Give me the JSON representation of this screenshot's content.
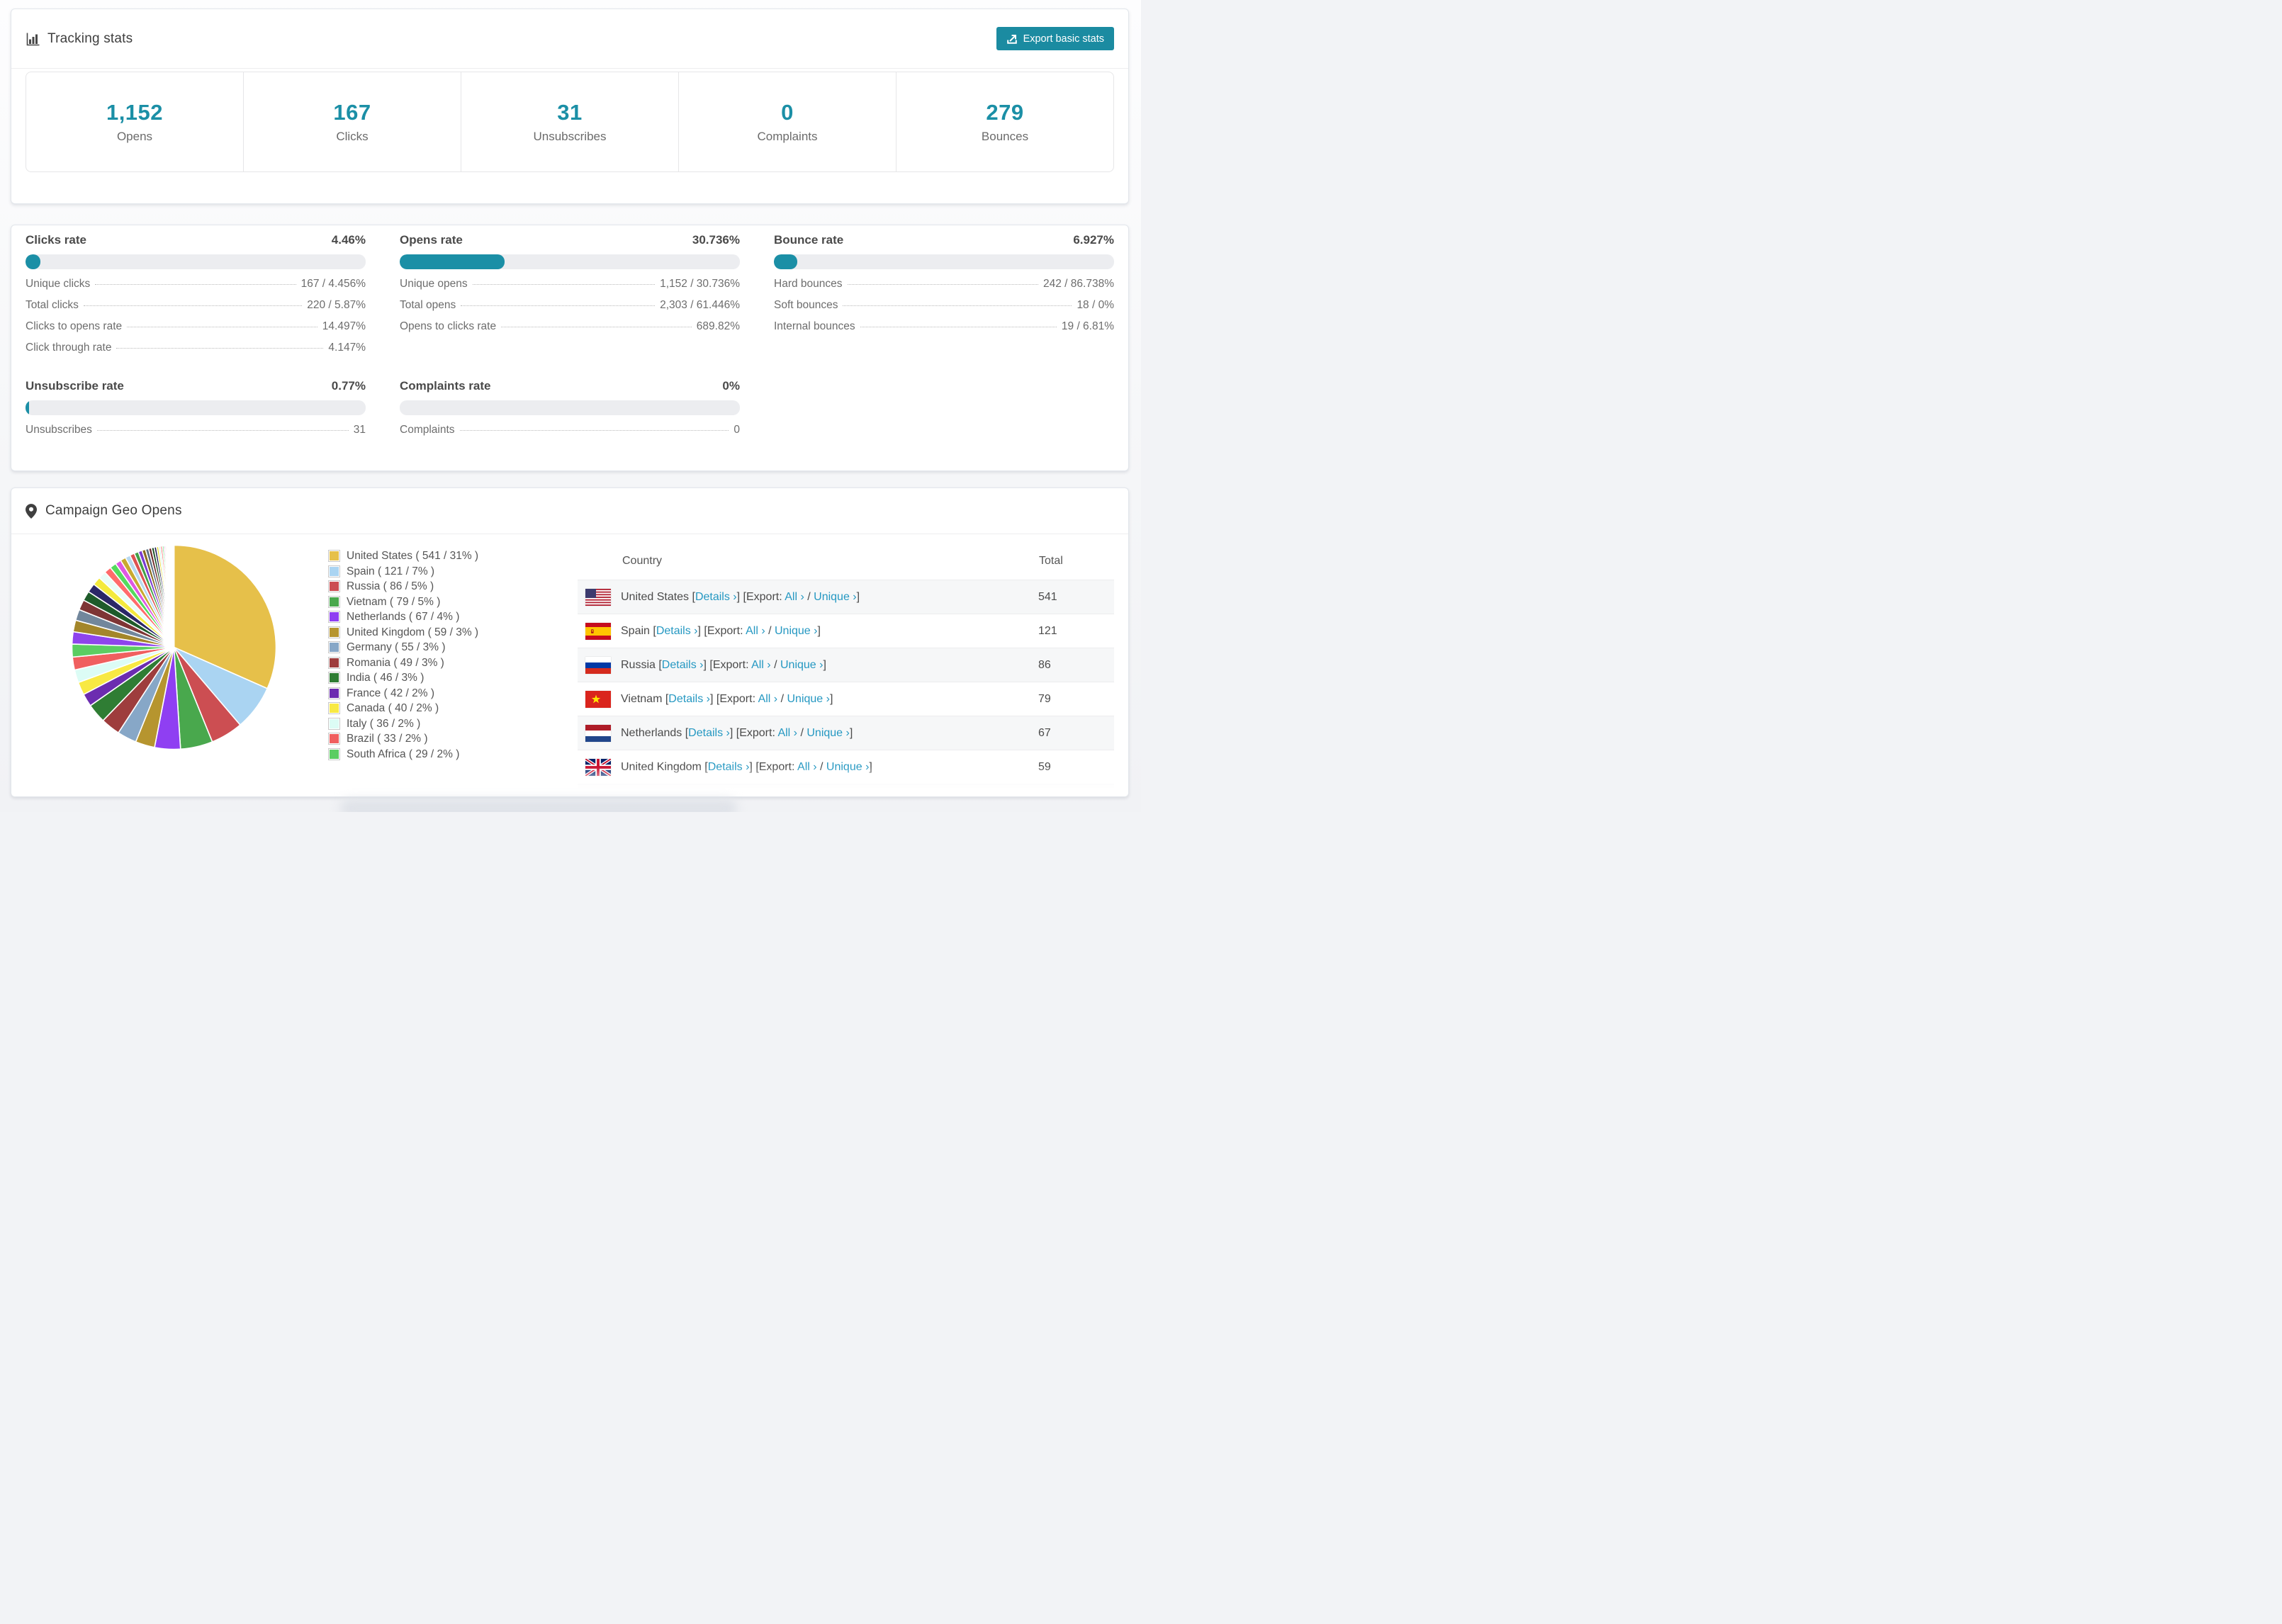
{
  "colors": {
    "accent_teal": "#1b8fa6",
    "button_teal": "#1b8ba1",
    "link_blue": "#2598c2",
    "bar_track": "#ecedf0",
    "table_alt_row": "#f6f7f8",
    "title_text": "#3e3e3e",
    "muted_text": "#6b6b6b"
  },
  "header_card": {
    "title": "Tracking stats",
    "export_button": "Export basic stats"
  },
  "stats": [
    {
      "label": "Opens",
      "value": "1,152"
    },
    {
      "label": "Clicks",
      "value": "167"
    },
    {
      "label": "Unsubscribes",
      "value": "31"
    },
    {
      "label": "Complaints",
      "value": "0"
    },
    {
      "label": "Bounces",
      "value": "279"
    }
  ],
  "rates": [
    {
      "title": "Clicks rate",
      "value": "4.46%",
      "percent": 4.46,
      "rows": [
        {
          "label": "Unique clicks",
          "value": "167 / 4.456%"
        },
        {
          "label": "Total clicks",
          "value": "220 / 5.87%"
        },
        {
          "label": "Clicks to opens rate",
          "value": "14.497%"
        },
        {
          "label": "Click through rate",
          "value": "4.147%"
        }
      ]
    },
    {
      "title": "Opens rate",
      "value": "30.736%",
      "percent": 30.736,
      "rows": [
        {
          "label": "Unique opens",
          "value": "1,152 / 30.736%"
        },
        {
          "label": "Total opens",
          "value": "2,303 / 61.446%"
        },
        {
          "label": "Opens to clicks rate",
          "value": "689.82%"
        }
      ]
    },
    {
      "title": "Bounce rate",
      "value": "6.927%",
      "percent": 6.927,
      "rows": [
        {
          "label": "Hard bounces",
          "value": "242 / 86.738%"
        },
        {
          "label": "Soft bounces",
          "value": "18 / 0%"
        },
        {
          "label": "Internal bounces",
          "value": "19 / 6.81%"
        }
      ]
    },
    {
      "title": "Unsubscribe rate",
      "value": "0.77%",
      "percent": 0.77,
      "rows": [
        {
          "label": "Unsubscribes",
          "value": "31"
        }
      ]
    },
    {
      "title": "Complaints rate",
      "value": "0%",
      "percent": 0,
      "rows": [
        {
          "label": "Complaints",
          "value": "0"
        }
      ]
    }
  ],
  "geo": {
    "title": "Campaign Geo Opens",
    "table": {
      "columns": [
        "Country",
        "Total"
      ],
      "links": {
        "details": "Details ›",
        "all": "All ›",
        "unique": "Unique ›",
        "export_label": "Export:",
        "lbracket": "[",
        "rbracket": "]",
        "slash": "/"
      },
      "rows": [
        {
          "country": "United States",
          "flag": "us",
          "total": "541"
        },
        {
          "country": "Spain",
          "flag": "es",
          "total": "121"
        },
        {
          "country": "Russia",
          "flag": "ru",
          "total": "86"
        },
        {
          "country": "Vietnam",
          "flag": "vn",
          "total": "79"
        },
        {
          "country": "Netherlands",
          "flag": "nl",
          "total": "67"
        },
        {
          "country": "United Kingdom",
          "flag": "gb",
          "total": "59"
        },
        {
          "country": "",
          "flag": "de",
          "total": "",
          "partial": true
        }
      ]
    }
  },
  "chart_data": {
    "type": "pie",
    "title": "Campaign Geo Opens",
    "legend_position": "right",
    "legend_format": "{label} ( {count} / {percent}% )",
    "slices": [
      {
        "label": "United States",
        "count": 541,
        "percent": 31,
        "color": "#e6c04a"
      },
      {
        "label": "Spain",
        "count": 121,
        "percent": 7,
        "color": "#aad4f2"
      },
      {
        "label": "Russia",
        "count": 86,
        "percent": 5,
        "color": "#cc4e52"
      },
      {
        "label": "Vietnam",
        "count": 79,
        "percent": 5,
        "color": "#49a84d"
      },
      {
        "label": "Netherlands",
        "count": 67,
        "percent": 4,
        "color": "#8f3ff2"
      },
      {
        "label": "United Kingdom",
        "count": 59,
        "percent": 3,
        "color": "#b6952f"
      },
      {
        "label": "Germany",
        "count": 55,
        "percent": 3,
        "color": "#87a7c7"
      },
      {
        "label": "Romania",
        "count": 49,
        "percent": 3,
        "color": "#9e3d3d"
      },
      {
        "label": "India",
        "count": 46,
        "percent": 3,
        "color": "#2f7d34"
      },
      {
        "label": "France",
        "count": 42,
        "percent": 2,
        "color": "#6c2cb0"
      },
      {
        "label": "Canada",
        "count": 40,
        "percent": 2,
        "color": "#f8e943"
      },
      {
        "label": "Italy",
        "count": 36,
        "percent": 2,
        "color": "#dcfcf5"
      },
      {
        "label": "Brazil",
        "count": 33,
        "percent": 2,
        "color": "#f05f5f"
      },
      {
        "label": "South Africa",
        "count": 29,
        "percent": 2,
        "color": "#5bcd62"
      }
    ],
    "unlabeled_tail": {
      "note": "long tail of small unlabeled country slices, estimated from pixels",
      "percents": [
        1.9,
        1.8,
        1.7,
        1.6,
        1.5,
        1.4,
        1.3,
        1.2,
        1.1,
        1.0,
        0.92,
        0.85,
        0.78,
        0.72,
        0.66,
        0.6,
        0.55,
        0.5,
        0.45,
        0.41,
        0.37,
        0.33,
        0.3,
        0.27,
        0.24,
        0.21,
        0.19,
        0.17,
        0.15,
        0.13,
        0.11,
        0.1,
        0.09,
        0.08,
        0.07,
        0.06,
        0.05,
        0.04,
        0.035,
        0.03,
        0.025,
        0.02
      ],
      "colors": [
        "#8e44ec",
        "#a3862a",
        "#72879c",
        "#7e3535",
        "#1e5b2a",
        "#2b2767",
        "#f4ea3d",
        "#e9fdf8",
        "#ff6b6b",
        "#54da5e",
        "#de58e3",
        "#c9a92f",
        "#b7d9f0",
        "#dd5252",
        "#43a047",
        "#7a3bd1",
        "#8a6d1f",
        "#5d7186",
        "#6e2a2a",
        "#1b4f22",
        "#241f58",
        "#e3d62f",
        "#cff3ea",
        "#f25757",
        "#3fcf52",
        "#c44fd1",
        "#ddc12c",
        "#a9cdea",
        "#cf4444",
        "#378a3c",
        "#6931b5",
        "#9b8326",
        "#4a5a6d",
        "#5c2222",
        "#12401b",
        "#1a1644",
        "#d4c428",
        "#baeade",
        "#e04848",
        "#35b945",
        "#b14fd1",
        "#caa93a"
      ]
    }
  }
}
